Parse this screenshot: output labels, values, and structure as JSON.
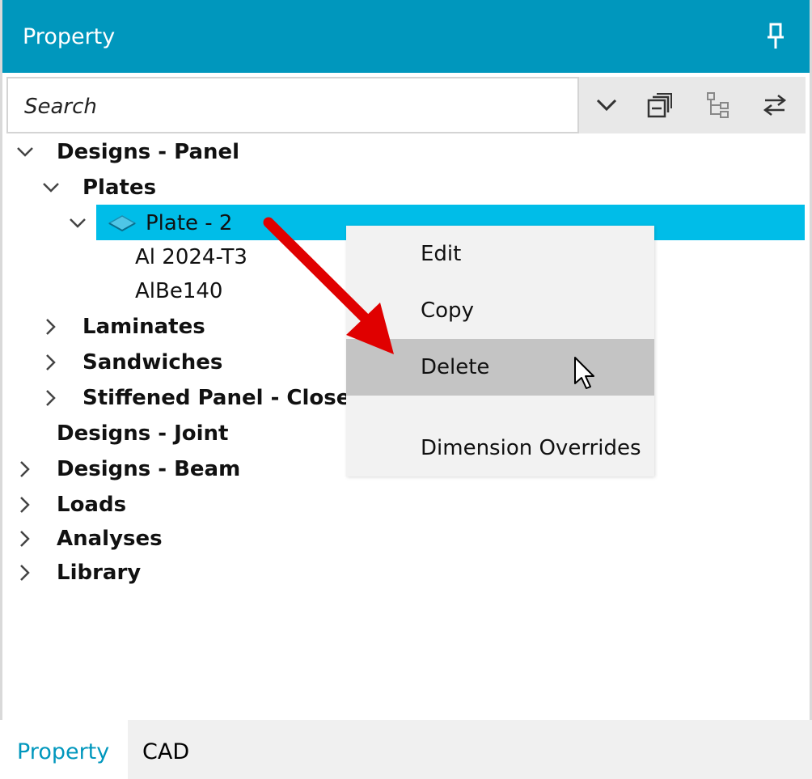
{
  "header": {
    "title": "Property",
    "pin_icon": "pin-icon"
  },
  "search": {
    "placeholder": "Search"
  },
  "toolbar": {
    "icons": [
      "chevron-down-icon",
      "collapse-all-icon",
      "tree-view-icon",
      "swap-icon"
    ]
  },
  "tree": {
    "designs_panel": "Designs - Panel",
    "plates": "Plates",
    "plate2": "Plate - 2",
    "al2024": "Al 2024-T3",
    "albe140": "AlBe140",
    "laminates": "Laminates",
    "sandwiches": "Sandwiches",
    "stiffened": "Stiffened Panel - Closed",
    "designs_joint": "Designs - Joint",
    "designs_beam": "Designs - Beam",
    "loads": "Loads",
    "analyses": "Analyses",
    "library": "Library"
  },
  "context_menu": {
    "edit": "Edit",
    "copy": "Copy",
    "delete": "Delete",
    "dimension_overrides": "Dimension Overrides",
    "hovered": "Delete"
  },
  "tabs": {
    "property": "Property",
    "cad": "CAD",
    "active": "Property"
  },
  "colors": {
    "accent": "#0097bd",
    "selection": "#00bde8",
    "arrow": "#e00000"
  }
}
